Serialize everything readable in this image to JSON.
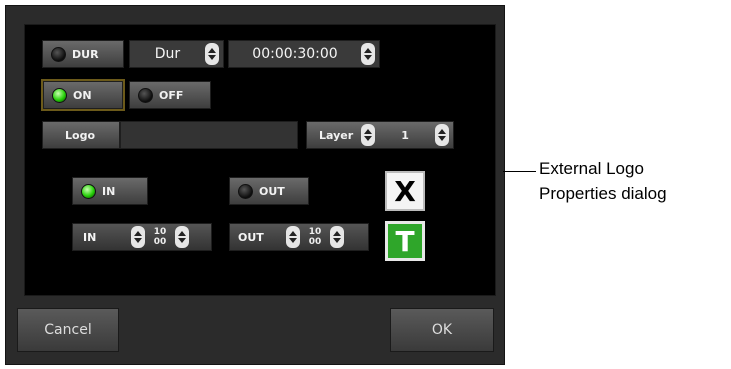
{
  "dur_toggle": {
    "label": "DUR"
  },
  "dur_mode": {
    "label": "Dur"
  },
  "duration": {
    "value": "00:00:30:00"
  },
  "on_button": {
    "label": "ON"
  },
  "off_button": {
    "label": "OFF"
  },
  "logo": {
    "label": "Logo",
    "value": ""
  },
  "layer": {
    "label": "Layer",
    "value": "1"
  },
  "in_toggle": {
    "label": "IN"
  },
  "out_toggle": {
    "label": "OUT"
  },
  "in_field": {
    "label": "IN",
    "top": "10",
    "bottom": "00"
  },
  "out_field": {
    "label": "OUT",
    "top": "10",
    "bottom": "00"
  },
  "x_icon": {
    "glyph": "X"
  },
  "t_icon": {
    "glyph": "T"
  },
  "cancel_button": {
    "label": "Cancel"
  },
  "ok_button": {
    "label": "OK"
  },
  "annotation": {
    "line1": "External Logo",
    "line2": "Properties dialog"
  }
}
